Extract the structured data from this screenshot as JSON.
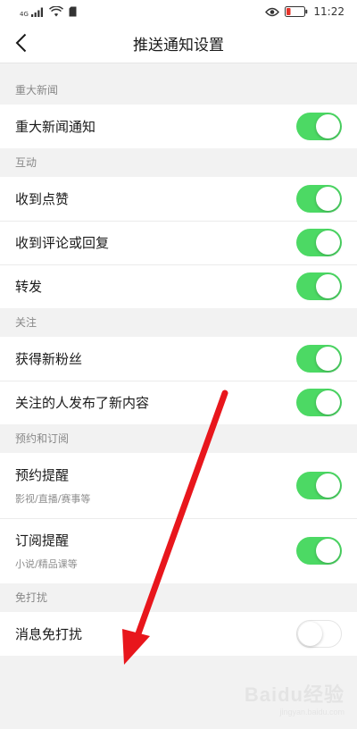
{
  "status_bar": {
    "signal_text": "4G",
    "time": "11:22"
  },
  "nav": {
    "title": "推送通知设置"
  },
  "sections": [
    {
      "header": "重大新闻",
      "items": [
        {
          "label": "重大新闻通知",
          "enabled": true
        }
      ]
    },
    {
      "header": "互动",
      "items": [
        {
          "label": "收到点赞",
          "enabled": true
        },
        {
          "label": "收到评论或回复",
          "enabled": true
        },
        {
          "label": "转发",
          "enabled": true
        }
      ]
    },
    {
      "header": "关注",
      "items": [
        {
          "label": "获得新粉丝",
          "enabled": true
        },
        {
          "label": "关注的人发布了新内容",
          "enabled": true
        }
      ]
    },
    {
      "header": "预约和订阅",
      "items": [
        {
          "label": "预约提醒",
          "sublabel": "影视/直播/赛事等",
          "enabled": true
        },
        {
          "label": "订阅提醒",
          "sublabel": "小说/精品课等",
          "enabled": true
        }
      ]
    },
    {
      "header": "免打扰",
      "items": [
        {
          "label": "消息免打扰",
          "enabled": false
        }
      ]
    }
  ],
  "watermark": {
    "main": "Baidu经验",
    "sub": "jingyan.baidu.com"
  },
  "colors": {
    "toggle_on": "#4cd964",
    "arrow": "#e8161c"
  },
  "icons": [
    "signal-icon",
    "wifi-icon",
    "sim-icon",
    "eye-icon",
    "battery-icon",
    "back-arrow-icon"
  ]
}
